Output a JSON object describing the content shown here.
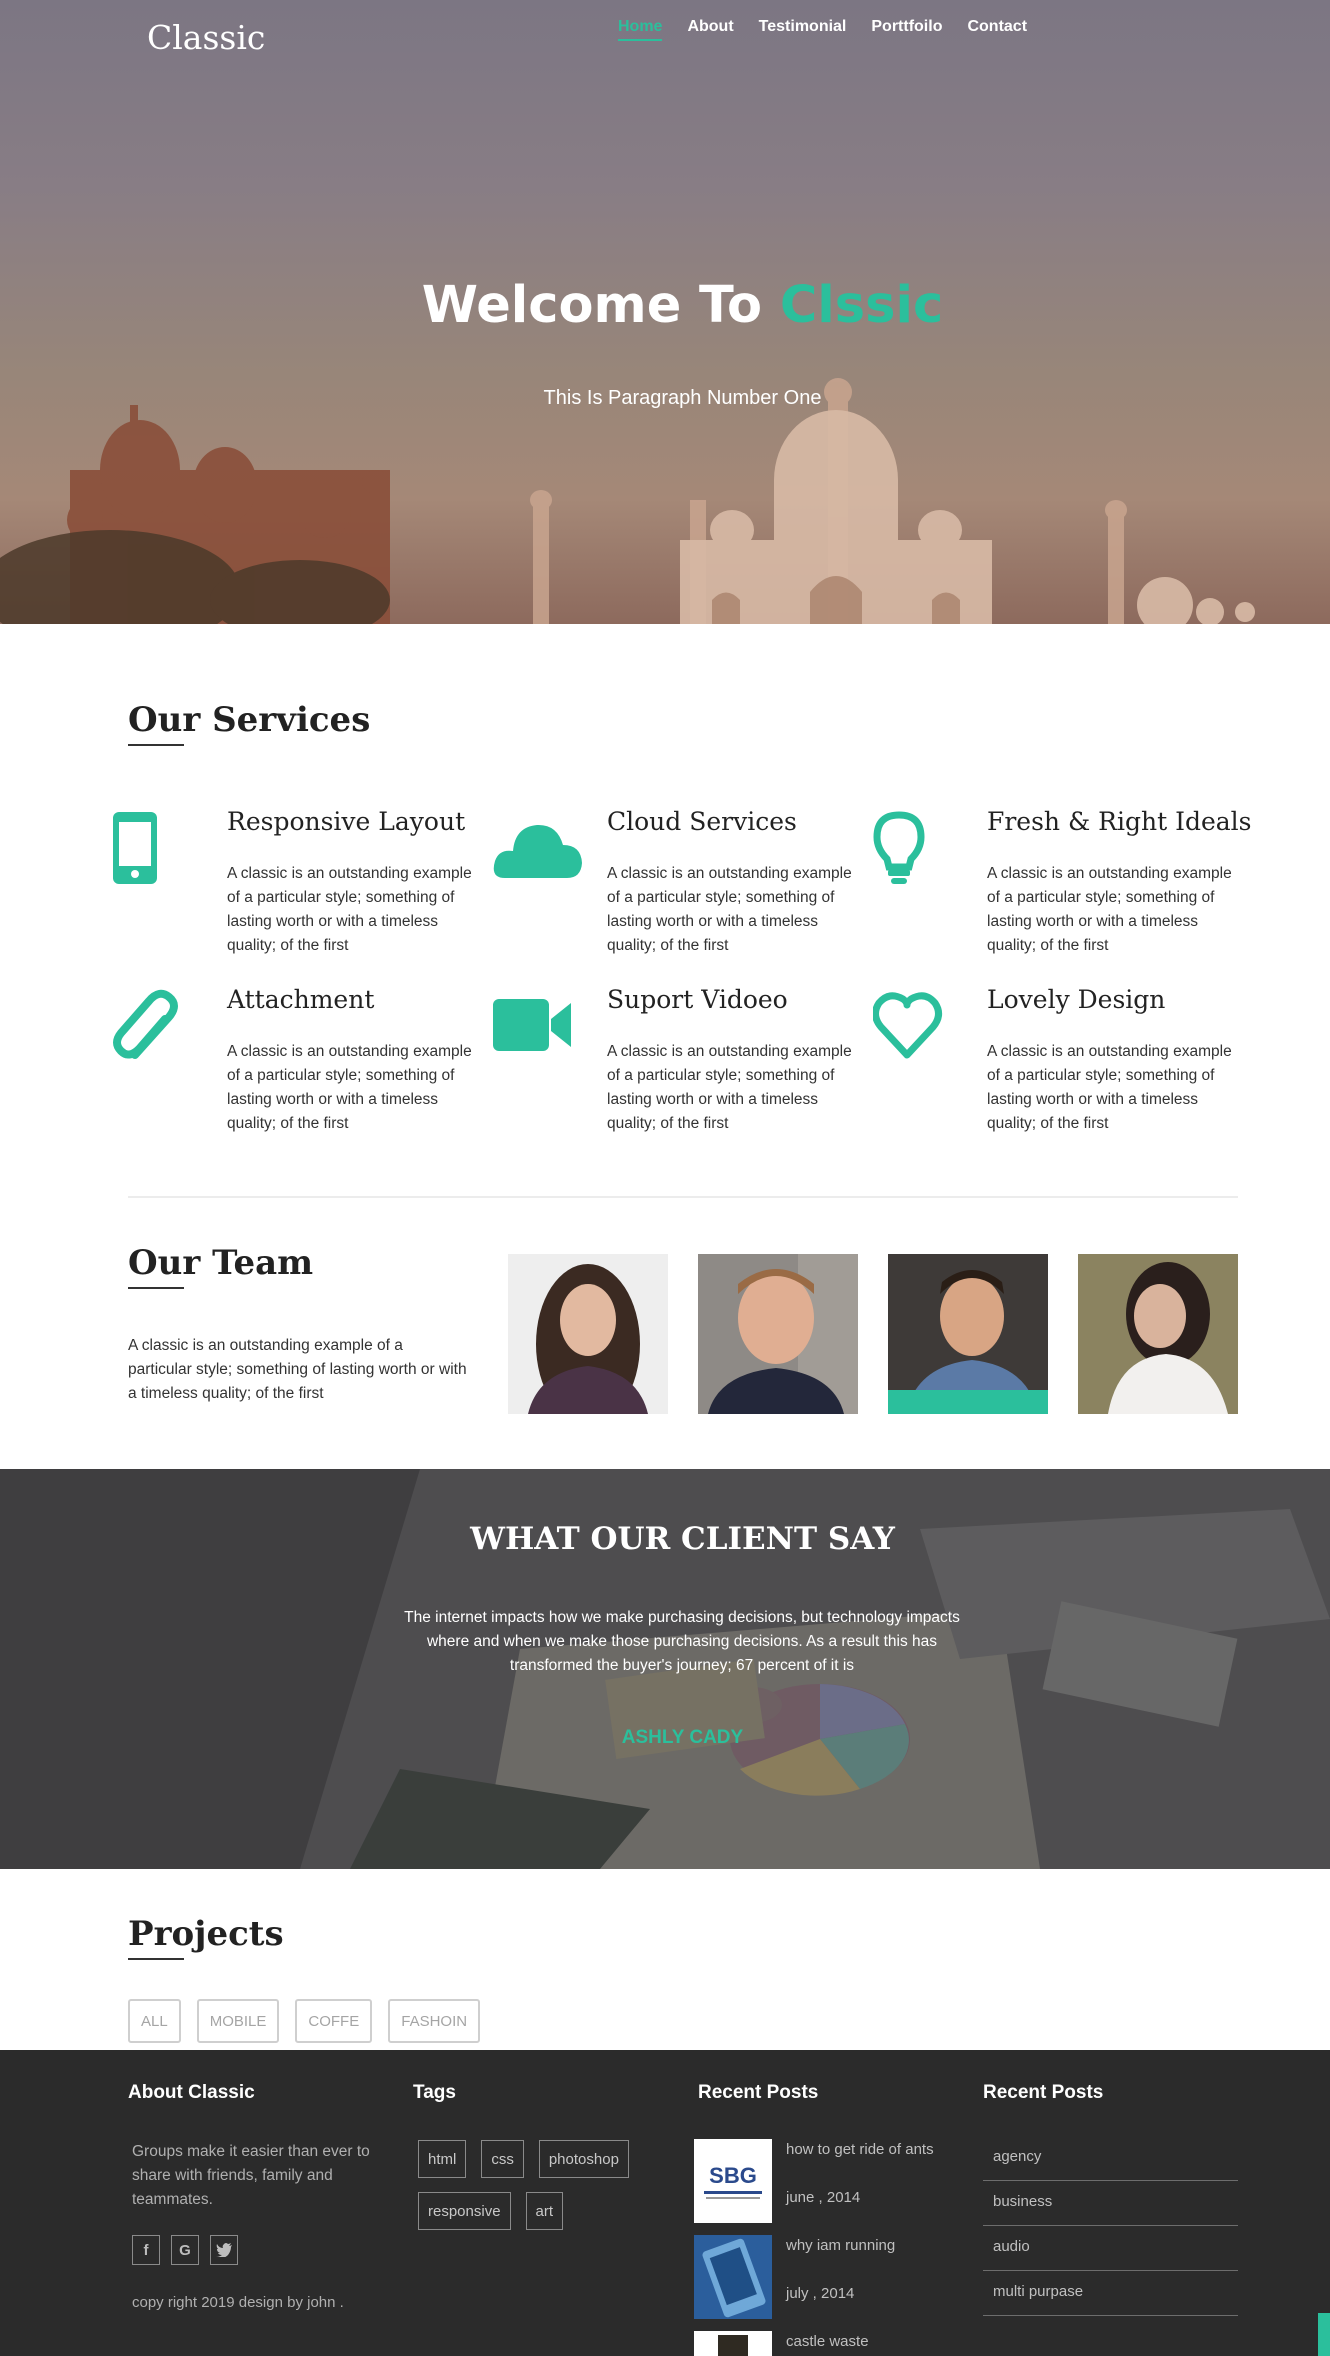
{
  "header": {
    "brand": "Classic",
    "nav": [
      {
        "label": "Home",
        "active": true
      },
      {
        "label": "About"
      },
      {
        "label": "Testimonial"
      },
      {
        "label": "Porttfoilo"
      },
      {
        "label": "Contact"
      }
    ]
  },
  "hero": {
    "title_prefix": "Welcome To",
    "title_accent": "Clssic",
    "subtitle": "This Is Paragraph Number One"
  },
  "services": {
    "title": "Our Services",
    "items": [
      {
        "title": "Responsive Layout",
        "icon": "mobile-phone-icon",
        "text": "A classic is an outstanding example of a particular style; something of lasting worth or with a timeless quality; of the first"
      },
      {
        "title": "Cloud Services",
        "icon": "cloud-icon",
        "text": "A classic is an outstanding example of a particular style; something of lasting worth or with a timeless quality; of the first"
      },
      {
        "title": "Fresh & Right Ideals",
        "icon": "lightbulb-icon",
        "text": "A classic is an outstanding example of a particular style; something of lasting worth or with a timeless quality; of the first"
      },
      {
        "title": "Attachment",
        "icon": "paperclip-icon",
        "text": "A classic is an outstanding example of a particular style; something of lasting worth or with a timeless quality; of the first"
      },
      {
        "title": "Suport Vidoeo",
        "icon": "video-camera-icon",
        "text": "A classic is an outstanding example of a particular style; something of lasting worth or with a timeless quality; of the first"
      },
      {
        "title": "Lovely Design",
        "icon": "heart-icon",
        "text": "A classic is an outstanding example of a particular style; something of lasting worth or with a timeless quality; of the first"
      }
    ]
  },
  "team": {
    "title": "Our Team",
    "text": "A classic is an outstanding example of a particular style; something of lasting worth or with a timeless quality; of the first"
  },
  "testimonial": {
    "title": "WHAT OUR CLIENT SAY",
    "text": "The internet impacts how we make purchasing decisions, but technology impacts where and when we make those purchasing decisions. As a result this has transformed the buyer's journey; 67 percent of it is",
    "author": "ASHLY CADY"
  },
  "projects": {
    "title": "Projects",
    "filters": [
      "ALL",
      "MOBILE",
      "COFFE",
      "FASHOIN"
    ]
  },
  "footer": {
    "about": {
      "heading": "About Classic",
      "text": "Groups make it easier than ever to share with friends, family and teammates.",
      "socials": [
        {
          "icon": "facebook-icon",
          "glyph": "f"
        },
        {
          "icon": "google-icon",
          "glyph": "G"
        },
        {
          "icon": "twitter-icon",
          "glyph": "t"
        }
      ],
      "copyright": "copy right 2019 design by john ."
    },
    "tags": {
      "heading": "Tags",
      "items": [
        "html",
        "css",
        "photoshop",
        "responsive",
        "art"
      ]
    },
    "recent_posts": {
      "heading": "Recent Posts",
      "posts": [
        {
          "title": "how to get ride of ants",
          "date": "june , 2014",
          "thumb_text": "SBG"
        },
        {
          "title": "why iam running",
          "date": "july , 2014"
        },
        {
          "title": "castle waste",
          "date": ""
        }
      ]
    },
    "categories": {
      "heading": "Recent Posts",
      "items": [
        "agency",
        "business",
        "audio",
        "multi purpase"
      ]
    }
  },
  "colors": {
    "accent": "#2bbf9c",
    "footer_bg": "#2b2b2b"
  }
}
